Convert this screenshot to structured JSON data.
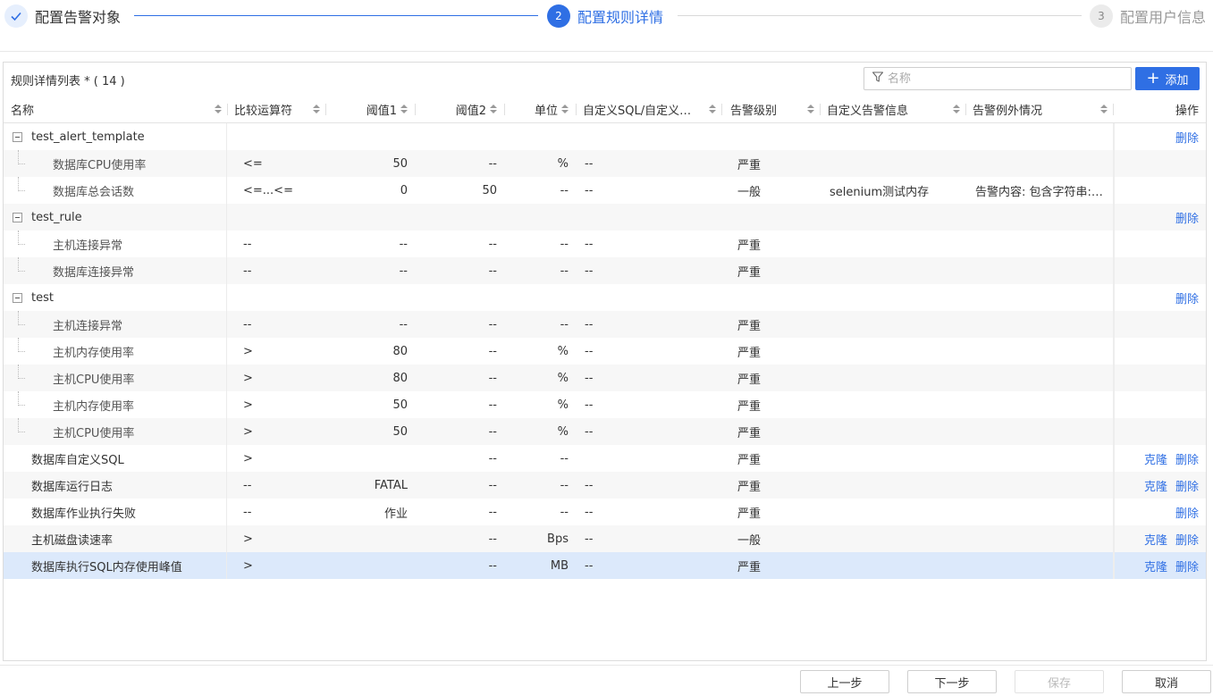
{
  "stepper": {
    "steps": [
      {
        "index": "✓",
        "label": "配置告警对象",
        "state": "done"
      },
      {
        "index": "2",
        "label": "配置规则详情",
        "state": "active"
      },
      {
        "index": "3",
        "label": "配置用户信息",
        "state": "todo"
      }
    ]
  },
  "panel": {
    "title": "规则详情列表 * ( 14 )",
    "search_placeholder": "名称",
    "search_value": "",
    "add_label": "添加"
  },
  "columns": [
    "名称",
    "比较运算符",
    "阈值1",
    "阈值2",
    "单位",
    "自定义SQL/自定义…",
    "告警级别",
    "自定义告警信息",
    "告警例外情况",
    "操作"
  ],
  "rows": [
    {
      "type": "group",
      "name": "test_alert_template",
      "actions": [
        "删除"
      ]
    },
    {
      "type": "child",
      "name": "数据库CPU使用率",
      "op": "<=",
      "t1": "50",
      "t2": "--",
      "unit": "%",
      "sql": "--",
      "level": "严重",
      "msg": "",
      "exc": "",
      "actions": []
    },
    {
      "type": "child",
      "name": "数据库总会话数",
      "op": "<=...<=",
      "t1": "0",
      "t2": "50",
      "unit": "--",
      "sql": "--",
      "level": "一般",
      "msg": "selenium测试内存",
      "exc": "告警内容: 包含字符串: ...",
      "actions": []
    },
    {
      "type": "group",
      "name": "test_rule",
      "actions": [
        "删除"
      ]
    },
    {
      "type": "child",
      "name": "主机连接异常",
      "op": "--",
      "t1": "--",
      "t2": "--",
      "unit": "--",
      "sql": "--",
      "level": "严重",
      "msg": "",
      "exc": "",
      "actions": []
    },
    {
      "type": "child",
      "name": "数据库连接异常",
      "op": "--",
      "t1": "--",
      "t2": "--",
      "unit": "--",
      "sql": "--",
      "level": "严重",
      "msg": "",
      "exc": "",
      "actions": []
    },
    {
      "type": "group",
      "name": "test",
      "actions": [
        "删除"
      ]
    },
    {
      "type": "child",
      "name": "主机连接异常",
      "op": "--",
      "t1": "--",
      "t2": "--",
      "unit": "--",
      "sql": "--",
      "level": "严重",
      "msg": "",
      "exc": "",
      "actions": []
    },
    {
      "type": "child",
      "name": "主机内存使用率",
      "op": ">",
      "t1": "80",
      "t2": "--",
      "unit": "%",
      "sql": "--",
      "level": "严重",
      "msg": "",
      "exc": "",
      "actions": []
    },
    {
      "type": "child",
      "name": "主机CPU使用率",
      "op": ">",
      "t1": "80",
      "t2": "--",
      "unit": "%",
      "sql": "--",
      "level": "严重",
      "msg": "",
      "exc": "",
      "actions": []
    },
    {
      "type": "child",
      "name": "主机内存使用率",
      "op": ">",
      "t1": "50",
      "t2": "--",
      "unit": "%",
      "sql": "--",
      "level": "严重",
      "msg": "",
      "exc": "",
      "actions": []
    },
    {
      "type": "child",
      "name": "主机CPU使用率",
      "op": ">",
      "t1": "50",
      "t2": "--",
      "unit": "%",
      "sql": "--",
      "level": "严重",
      "msg": "",
      "exc": "",
      "actions": []
    },
    {
      "type": "leaf",
      "name": "数据库自定义SQL",
      "op": ">",
      "t1": "",
      "t2": "--",
      "unit": "--",
      "sql": "",
      "level": "严重",
      "msg": "",
      "exc": "",
      "actions": [
        "克隆",
        "删除"
      ]
    },
    {
      "type": "leaf",
      "name": "数据库运行日志",
      "op": "--",
      "t1": "FATAL",
      "t2": "--",
      "unit": "--",
      "sql": "--",
      "level": "严重",
      "msg": "",
      "exc": "",
      "actions": [
        "克隆",
        "删除"
      ]
    },
    {
      "type": "leaf",
      "name": "数据库作业执行失败",
      "op": "--",
      "t1": "作业",
      "t2": "--",
      "unit": "--",
      "sql": "--",
      "level": "严重",
      "msg": "",
      "exc": "",
      "actions": [
        "删除"
      ]
    },
    {
      "type": "leaf",
      "name": "主机磁盘读速率",
      "op": ">",
      "t1": "",
      "t2": "--",
      "unit": "Bps",
      "sql": "--",
      "level": "一般",
      "msg": "",
      "exc": "",
      "actions": [
        "克隆",
        "删除"
      ]
    },
    {
      "type": "leaf",
      "name": "数据库执行SQL内存使用峰值",
      "op": ">",
      "t1": "",
      "t2": "--",
      "unit": "MB",
      "sql": "--",
      "level": "严重",
      "msg": "",
      "exc": "",
      "actions": [
        "克隆",
        "删除"
      ],
      "selected": true
    }
  ],
  "footer": {
    "prev_label": "上一步",
    "next_label": "下一步",
    "save_label": "保存",
    "cancel_label": "取消"
  },
  "colors": {
    "accent": "#2f6fe4",
    "selected_row": "#dce9fb",
    "alt_row": "#f7f7f7"
  }
}
